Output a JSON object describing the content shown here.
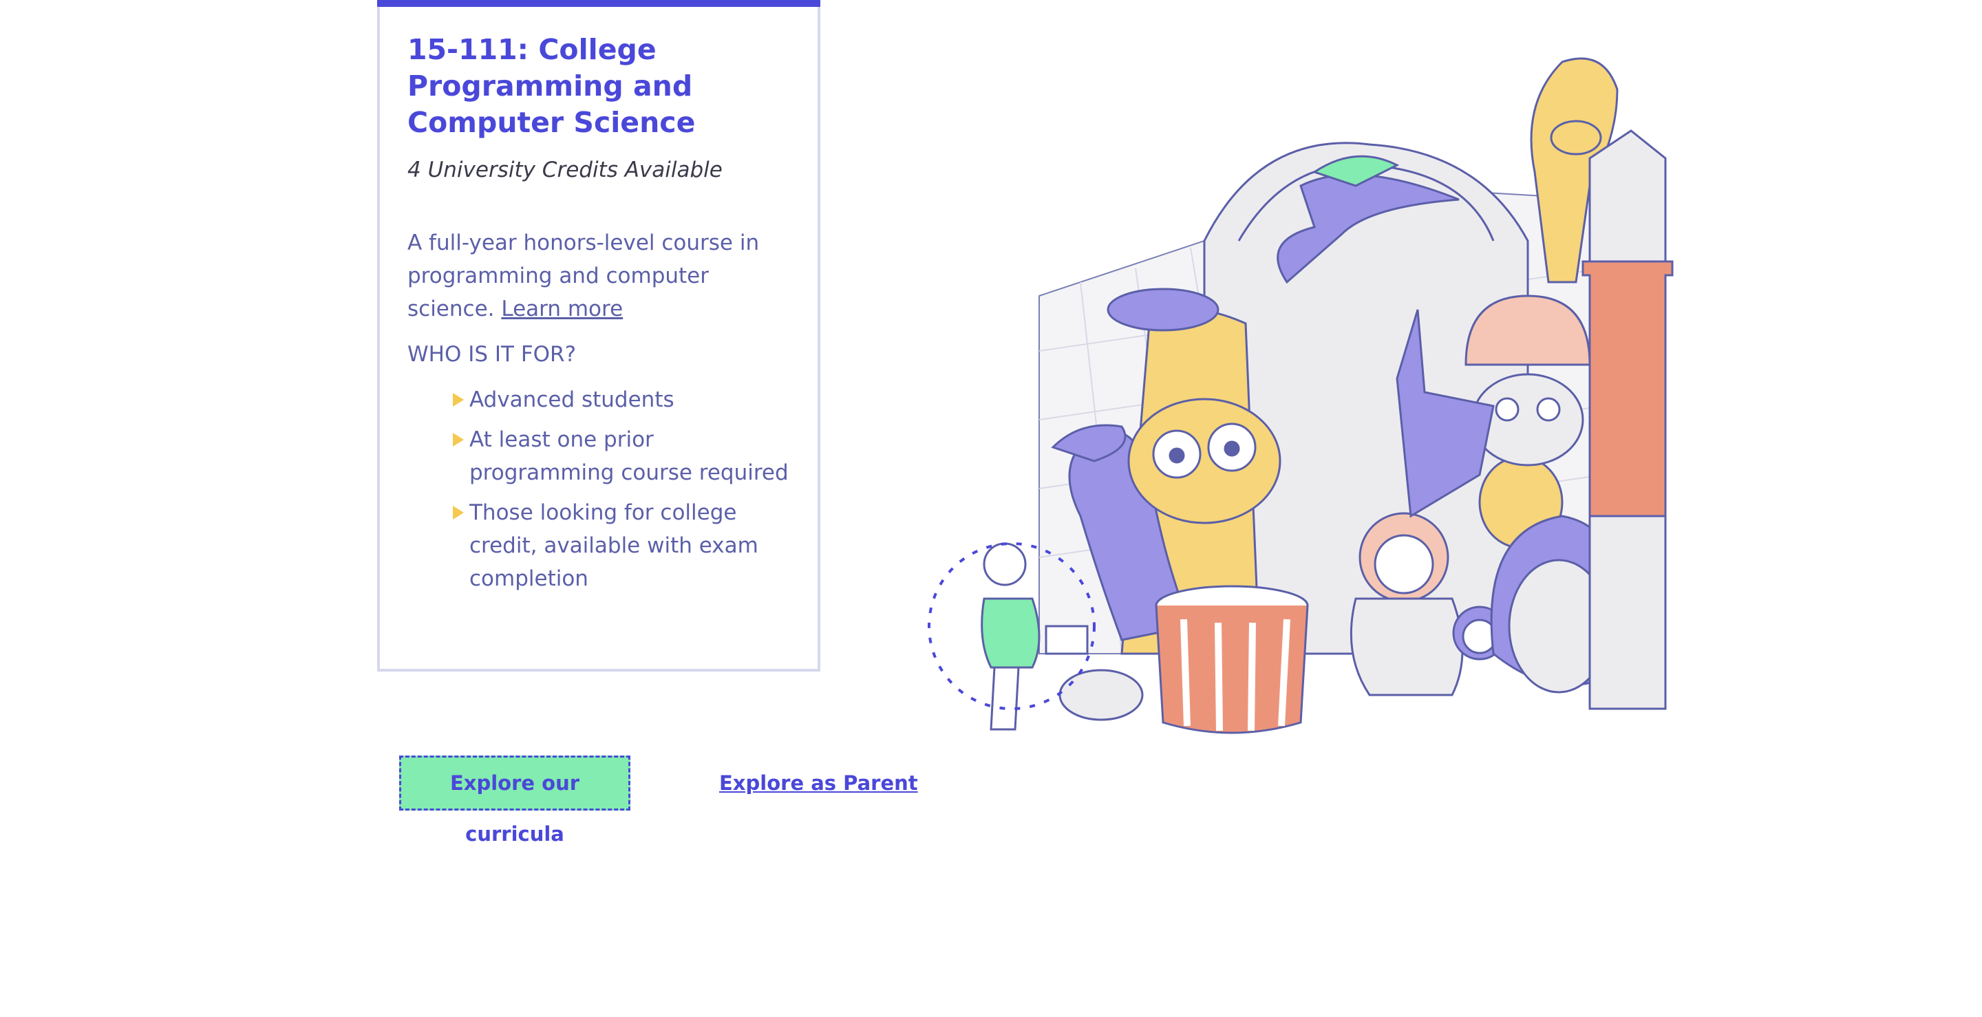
{
  "course_card": {
    "title": "15-111: College Programming and Computer Science",
    "credits": "4 University Credits Available",
    "description": "A full-year honors-level course in programming and computer science.",
    "learn_more": "Learn more",
    "audience_heading": "WHO IS IT FOR?",
    "audience": [
      "Advanced students",
      "At least one prior programming course required",
      "Those looking for college credit, available with exam completion"
    ]
  },
  "actions": {
    "explore_curricula": "Explore our curricula",
    "explore_parent": "Explore as Parent"
  },
  "colors": {
    "brand_purple": "#4a48d9",
    "text_muted": "#5b5fa8",
    "cta_green": "#83ecb0",
    "bullet_yellow": "#f5c84f"
  }
}
